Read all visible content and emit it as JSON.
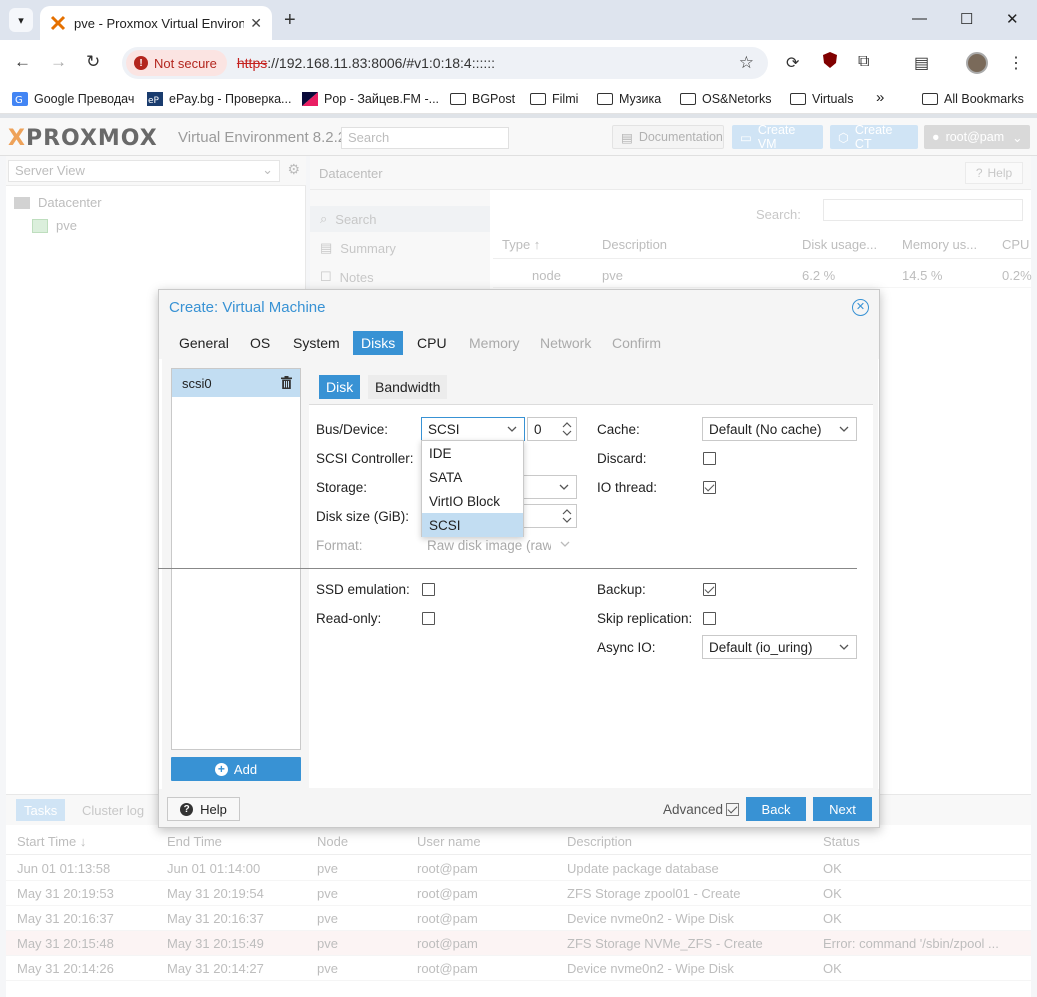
{
  "browser": {
    "tab_title": "pve - Proxmox Virtual Environment",
    "not_secure": "Not secure",
    "url_scheme": "https",
    "url_rest": "://192.168.11.83:8006/#v1:0:18:4::::::",
    "bookmarks": [
      {
        "label": "Google Преводач",
        "type": "site"
      },
      {
        "label": "ePay.bg - Проверка...",
        "type": "site"
      },
      {
        "label": "Pop - Зайцев.FM -...",
        "type": "site"
      },
      {
        "label": "BGPost",
        "type": "folder"
      },
      {
        "label": "Filmi",
        "type": "folder"
      },
      {
        "label": "Музика",
        "type": "folder"
      },
      {
        "label": "OS&Netorks",
        "type": "folder"
      },
      {
        "label": "Virtuals",
        "type": "folder"
      }
    ],
    "more_bookmarks": "»",
    "all_bookmarks": "All Bookmarks"
  },
  "pve": {
    "logo_x": "X",
    "logo_text": "PROXMOX",
    "version": "Virtual Environment 8.2.2",
    "search_placeholder": "Search",
    "btn_documentation": "Documentation",
    "btn_create_vm": "Create VM",
    "btn_create_ct": "Create CT",
    "user": "root@pam",
    "server_view": "Server View",
    "tree": {
      "datacenter": "Datacenter",
      "node": "pve"
    },
    "content_title": "Datacenter",
    "help": "Help",
    "nav": [
      "Search",
      "Summary",
      "Notes"
    ],
    "grid": {
      "search_label": "Search:",
      "headers": [
        "Type ↑",
        "Description",
        "Disk usage...",
        "Memory us...",
        "CPU"
      ],
      "row": {
        "type": "node",
        "description": "pve",
        "disk": "6.2 %",
        "memory": "14.5 %",
        "cpu": "0.2%"
      }
    },
    "tasks": {
      "tabs": [
        "Tasks",
        "Cluster log"
      ],
      "headers": [
        "Start Time ↓",
        "End Time",
        "Node",
        "User name",
        "Description",
        "Status"
      ],
      "rows": [
        {
          "start": "Jun 01 01:13:58",
          "end": "Jun 01 01:14:00",
          "node": "pve",
          "user": "root@pam",
          "desc": "Update package database",
          "status": "OK"
        },
        {
          "start": "May 31 20:19:53",
          "end": "May 31 20:19:54",
          "node": "pve",
          "user": "root@pam",
          "desc": "ZFS Storage zpool01 - Create",
          "status": "OK"
        },
        {
          "start": "May 31 20:16:37",
          "end": "May 31 20:16:37",
          "node": "pve",
          "user": "root@pam",
          "desc": "Device nvme0n2 - Wipe Disk",
          "status": "OK"
        },
        {
          "start": "May 31 20:15:48",
          "end": "May 31 20:15:49",
          "node": "pve",
          "user": "root@pam",
          "desc": "ZFS Storage NVMe_ZFS - Create",
          "status": "Error: command '/sbin/zpool ..."
        },
        {
          "start": "May 31 20:14:26",
          "end": "May 31 20:14:27",
          "node": "pve",
          "user": "root@pam",
          "desc": "Device nvme0n2 - Wipe Disk",
          "status": "OK"
        }
      ]
    }
  },
  "modal": {
    "title": "Create: Virtual Machine",
    "tabs": [
      "General",
      "OS",
      "System",
      "Disks",
      "CPU",
      "Memory",
      "Network",
      "Confirm"
    ],
    "disk_item": "scsi0",
    "add": "Add",
    "subtabs": [
      "Disk",
      "Bandwidth"
    ],
    "fields": {
      "bus_device": "Bus/Device:",
      "bus_value": "SCSI",
      "device_num": "0",
      "scsi_controller": "SCSI Controller:",
      "storage": "Storage:",
      "disk_size": "Disk size (GiB):",
      "format": "Format:",
      "format_value": "Raw disk image (raw",
      "cache": "Cache:",
      "cache_value": "Default (No cache)",
      "discard": "Discard:",
      "io_thread": "IO thread:",
      "ssd_emulation": "SSD emulation:",
      "read_only": "Read-only:",
      "backup": "Backup:",
      "skip_replication": "Skip replication:",
      "async_io": "Async IO:",
      "async_io_value": "Default (io_uring)"
    },
    "checks": {
      "discard": false,
      "io_thread": true,
      "ssd_emulation": false,
      "read_only": false,
      "backup": true,
      "skip_replication": false
    },
    "dropdown": [
      "IDE",
      "SATA",
      "VirtIO Block",
      "SCSI"
    ],
    "dropdown_selected": "SCSI",
    "footer": {
      "help": "Help",
      "advanced": "Advanced",
      "advanced_checked": true,
      "back": "Back",
      "next": "Next"
    }
  }
}
